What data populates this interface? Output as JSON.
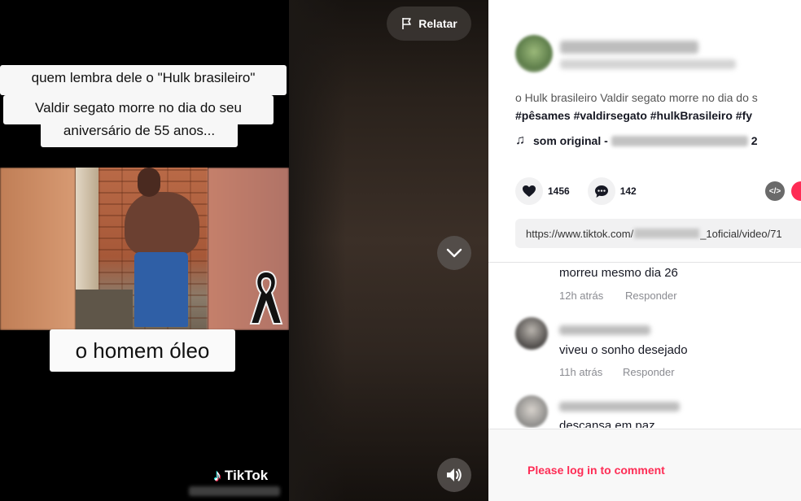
{
  "video": {
    "caption_line1": "quem lembra dele o \"Hulk brasileiro\"",
    "caption_line2": "Valdir segato morre no dia do seu",
    "caption_line3": "aniversário de 55 anos...",
    "caption_bottom": "o homem óleo",
    "watermark": "TikTok"
  },
  "controls": {
    "report_label": "Relatar"
  },
  "post": {
    "description": "o Hulk brasileiro Valdir segato morre no dia do s",
    "hashtags": "#pêsames #valdirsegato #hulkBrasileiro #fy",
    "music_prefix": "som original -",
    "music_suffix": "2",
    "likes": "1456",
    "comments": "142",
    "embed_icon": "</>",
    "url_prefix": "https://www.tiktok.com/",
    "url_suffix": "_1oficial/video/71"
  },
  "comments": [
    {
      "text": "morreu mesmo dia 26",
      "time": "12h atrás",
      "reply": "Responder"
    },
    {
      "text": "viveu o sonho desejado",
      "time": "11h atrás",
      "reply": "Responder"
    },
    {
      "text": "descansa em paz"
    }
  ],
  "login_prompt": "Please log in to comment",
  "colors": {
    "accent": "#fe2c55",
    "panel_bg": "#ffffff",
    "muted": "#8a8b91"
  }
}
